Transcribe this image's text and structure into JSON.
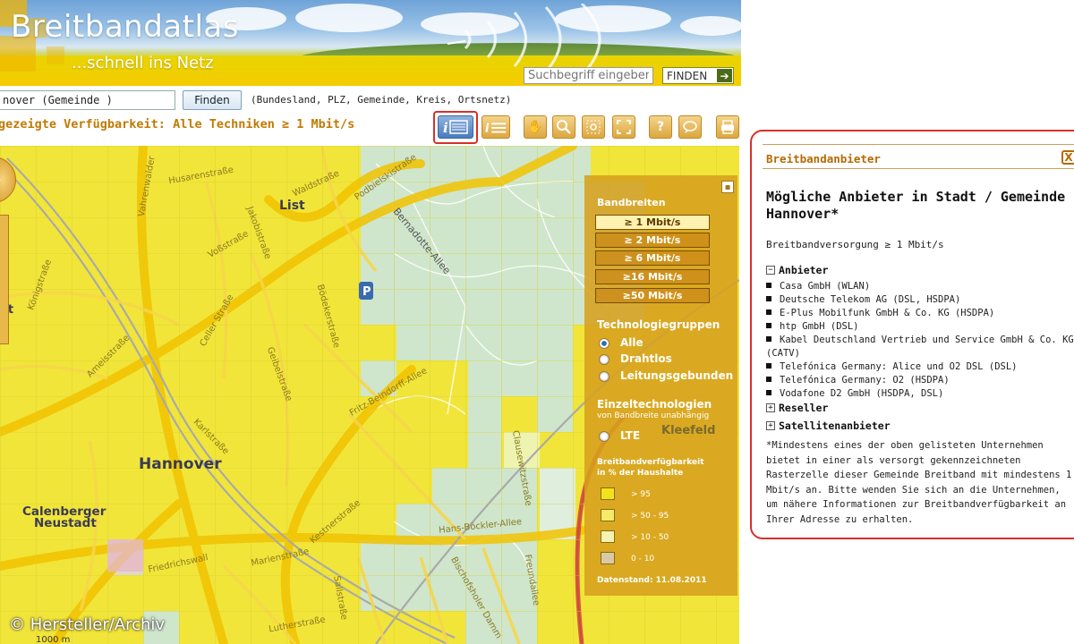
{
  "banner": {
    "title": "Breitbandatlas",
    "subtitle": "...schnell ins Netz",
    "search_placeholder": "Suchbegriff eingeben",
    "find_label": "FINDEN"
  },
  "search": {
    "value": "nover (Gemeinde )",
    "button_label": "Finden",
    "hint": "(Bundesland, PLZ, Gemeinde, Kreis, Ortsnetz)"
  },
  "availability_line": "gezeigte Verfügbarkeit: Alle Techniken ≥ 1 Mbit/s",
  "map": {
    "labels": {
      "list": "List",
      "hannover": "Hannover",
      "calenberger": "Calenberger",
      "neustadt": "Neustadt",
      "kleefeld": "Kleefeld",
      "left_edge": "et"
    },
    "streets": [
      "Husarenstraße",
      "Waldstraße",
      "Podbielskistraße",
      "Vahrenwalder",
      "Jakobistraße",
      "Voßstraße",
      "Bernadotte-Allee",
      "Celler Straße",
      "Bödekerstraße",
      "Fritz-Beindorff-Allee",
      "Hans-Böckler-Allee",
      "Marienstraße",
      "Clausewitzstraße",
      "Sallstraße",
      "Bischofsholer Damm",
      "Kestnerstraße",
      "Königstraße",
      "Friedrichswall",
      "Lutherstraße",
      "Freundallee",
      "Geibelstraße",
      "Ameisstraße",
      "Karlstraße"
    ],
    "scale": "1000 m"
  },
  "overlay": {
    "bandwidth_title": "Bandbreiten",
    "bandwidths": [
      "≥ 1 Mbit/s",
      "≥ 2 Mbit/s",
      "≥ 6 Mbit/s",
      "≥16 Mbit/s",
      "≥50 Mbit/s"
    ],
    "selected_bandwidth_index": 0,
    "techgroups_title": "Technologiegruppen",
    "techgroups": [
      "Alle",
      "Drahtlos",
      "Leitungsgebunden"
    ],
    "selected_techgroup_index": 0,
    "single_title": "Einzeltechnologien",
    "single_sub": "von Bandbreite unabhängig",
    "single_options": [
      "LTE"
    ],
    "legend_title": "Breitbandverfügbarkeit",
    "legend_sub": "in % der Haushalte",
    "legend": [
      {
        "label": "> 95",
        "color": "#f3e21a"
      },
      {
        "label": "> 50 - 95",
        "color": "#f5ea6a"
      },
      {
        "label": "> 10 - 50",
        "color": "#f8f2b0"
      },
      {
        "label": "0 - 10",
        "color": "#d9c9a8"
      }
    ],
    "date": "Datenstand: 11.08.2011"
  },
  "copyright": "© Hersteller/Archiv",
  "panel": {
    "title": "Breitbandanbieter",
    "close_label": "X",
    "heading": "Mögliche Anbieter in Stadt / Gemeinde Hannover*",
    "supply": "Breitbandversorgung ≥ 1 Mbit/s",
    "anbieter_label": "Anbieter",
    "anbieter_toggle": "−",
    "providers": [
      "Casa GmbH (WLAN)",
      "Deutsche Telekom AG (DSL, HSDPA)",
      "E-Plus Mobilfunk GmbH & Co. KG (HSDPA)",
      "htp GmbH (DSL)",
      "Kabel Deutschland Vertrieb und Service GmbH & Co. KG (CATV)",
      "Telefónica Germany: Alice und O2 DSL (DSL)",
      "Telefónica Germany: O2 (HSDPA)",
      "Vodafone D2 GmbH (HSDPA, DSL)"
    ],
    "reseller_label": "Reseller",
    "reseller_toggle": "+",
    "satellite_label": "Satellitenanbieter",
    "satellite_toggle": "+",
    "note": "*Mindestens eines der oben gelisteten Unternehmen bietet in einer als versorgt gekennzeichneten Rasterzelle dieser Gemeinde Breitband mit mindestens 1 Mbit/s an. Bitte wenden Sie sich an die Unternehmen, um nähere Informationen zur Breitbandverfügbarkeit an Ihrer Adresse zu erhalten."
  }
}
